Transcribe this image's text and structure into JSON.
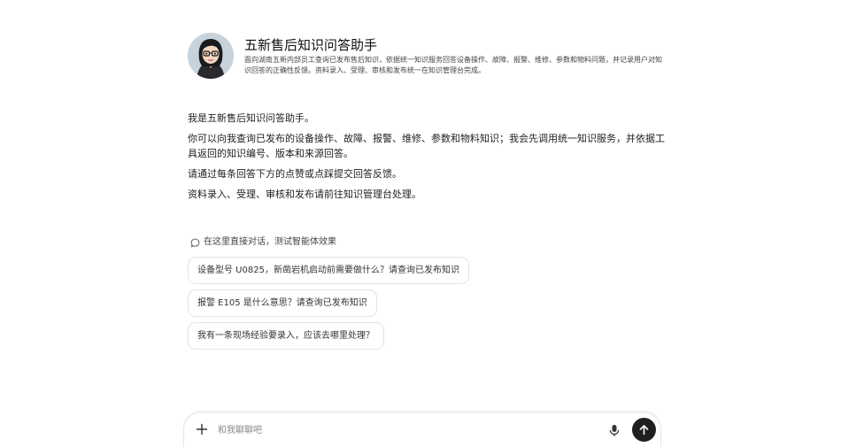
{
  "assistant": {
    "name": "五新售后知识问答助手",
    "description": "面向湖南五新内部员工查询已发布售后知识，依据统一知识服务回答设备操作、故障、报警、维修、参数和物料问题，并记录用户对知识回答的正确性反馈。资料录入、受理、审核和发布统一在知识管理台完成。",
    "avatar_icon": "avatar-icon"
  },
  "intro": {
    "lines": [
      "我是五新售后知识问答助手。",
      "你可以向我查询已发布的设备操作、故障、报警、维修、参数和物料知识；我会先调用统一知识服务，并依据工具返回的知识编号、版本和来源回答。",
      "请通过每条回答下方的点赞或点踩提交回答反馈。",
      "资料录入、受理、审核和发布请前往知识管理台处理。"
    ]
  },
  "hint": {
    "icon": "chat-bubble-icon",
    "text": "在这里直接对话，测试智能体效果"
  },
  "suggestions": [
    "设备型号 U0825，新凿岩机启动前需要做什么？请查询已发布知识",
    "报警 E105 是什么意思？请查询已发布知识",
    "我有一条现场经验要录入，应该去哪里处理？"
  ],
  "composer": {
    "placeholder": "和我聊聊吧",
    "value": "",
    "plus_icon": "plus-icon",
    "mic_icon": "microphone-icon",
    "send_icon": "arrow-up-icon"
  },
  "colors": {
    "send_button": "#1f1f1f",
    "chip_border": "#e3e3e3",
    "background": "#ffffff"
  }
}
